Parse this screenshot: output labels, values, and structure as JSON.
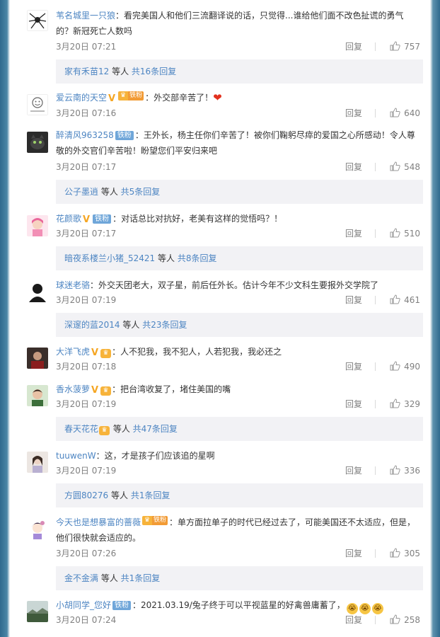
{
  "comments": [
    {
      "user": "苇名城里一只狼",
      "text": "：看完美国人和他们三流翻译说的话，只觉得...谁给他们面不改色扯谎的勇气的？新冠死亡人数吗",
      "date": "3月20日 07:21",
      "reply": "回复",
      "likes": "757",
      "thread_user": "家有禾苗12",
      "thread_mid": " 等人 ",
      "thread_more": "共16条回复"
    },
    {
      "user": "爱云南的天空",
      "badge_v": "V",
      "badge_crown": "♛",
      "badge_fan": "铁粉",
      "text": "：外交部辛苦了！",
      "heart": "❤",
      "date": "3月20日 07:16",
      "reply": "回复",
      "likes": "640"
    },
    {
      "user": "醉清风963258",
      "badge_fan": "铁粉",
      "text": "：王外长，杨主任你们辛苦了！被你们鞠躬尽瘁的爱国之心所感动！令人尊敬的外交官们辛苦啦！盼望您们平安归来吧",
      "date": "3月20日 07:17",
      "reply": "回复",
      "likes": "548",
      "thread_user": "公子墨逍",
      "thread_mid": " 等人 ",
      "thread_more": "共5条回复"
    },
    {
      "user": "花颜歌",
      "badge_v": "V",
      "badge_fan": "铁粉",
      "text": "：对话总比对抗好，老美有这样的觉悟吗？！",
      "date": "3月20日 07:17",
      "reply": "回复",
      "likes": "510",
      "thread_user": "暗夜系楼兰小猪_52421",
      "thread_mid": " 等人 ",
      "thread_more": "共8条回复"
    },
    {
      "user": "球迷老骆",
      "text": "：外交天团老大，双子星，前后任外长。估计今年不少文科生要报外交学院了",
      "date": "3月20日 07:19",
      "reply": "回复",
      "likes": "461",
      "thread_user": "深邃的蓝2014",
      "thread_mid": " 等人 ",
      "thread_more": "共23条回复"
    },
    {
      "user": "大洋飞虎",
      "badge_v": "V",
      "badge_crown": "♛",
      "text": "：人不犯我，我不犯人，人若犯我，我必还之",
      "date": "3月20日 07:18",
      "reply": "回复",
      "likes": "490"
    },
    {
      "user": "香水菠萝",
      "badge_v": "V",
      "badge_crown": "♛",
      "text": "：把台湾收复了，堵住美国的嘴",
      "date": "3月20日 07:19",
      "reply": "回复",
      "likes": "329",
      "thread_user": "春天花花",
      "thread_crown": "♛",
      "thread_mid": " 等人 ",
      "thread_more": "共47条回复"
    },
    {
      "user": "tuuwenW",
      "text": "：这，才是孩子们应该追的星啊",
      "date": "3月20日 07:19",
      "reply": "回复",
      "likes": "336",
      "thread_user": "方圆80276",
      "thread_mid": " 等人 ",
      "thread_more": "共1条回复"
    },
    {
      "user": "今天也是想暴富的蔷薇",
      "badge_crown": "♛",
      "badge_fan": "铁粉",
      "text": "：单方面拉单子的时代已经过去了，可能美国还不太适应，但是，他们很快就会适应的。",
      "date": "3月20日 07:26",
      "reply": "回复",
      "likes": "305",
      "thread_user": "金不金满",
      "thread_mid": " 等人 ",
      "thread_more": "共1条回复"
    },
    {
      "user": "小胡同学_您好",
      "badge_fan": "铁粉",
      "text": "：2021.03.19/兔子终于可以平视蓝星的好禽兽庸蓄了，",
      "emojis": [
        "😭",
        "😭",
        "😭"
      ],
      "date": "3月20日 07:24",
      "reply": "回复",
      "likes": "258"
    }
  ],
  "colors": {
    "username_orange": "#eb7350",
    "link_blue": "#4d85c2",
    "meta_gray": "#808080",
    "thread_bg": "#f2f2f5"
  },
  "icons": {
    "like": "thumbs-up-icon"
  }
}
